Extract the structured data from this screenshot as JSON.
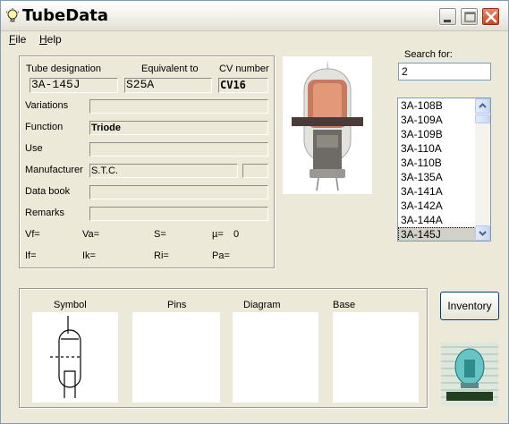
{
  "window": {
    "title": "TubeData"
  },
  "menu": [
    {
      "label": "File",
      "accel": "F",
      "rest": "ile"
    },
    {
      "label": "Help",
      "accel": "H",
      "rest": "elp"
    }
  ],
  "details": {
    "tube_designation_label": "Tube designation",
    "tube_designation_value": "3A-145J",
    "equivalent_label": "Equivalent to",
    "equivalent_value": "S25A",
    "cv_label": "CV number",
    "cv_value": "CV16",
    "variations_label": "Variations",
    "variations_value": "",
    "function_label": "Function",
    "function_value": "Triode",
    "use_label": "Use",
    "use_value": "",
    "manufacturer_label": "Manufacturer",
    "manufacturer_value": "S.T.C.",
    "manufacturer_extra": "",
    "databook_label": "Data book",
    "databook_value": "",
    "remarks_label": "Remarks",
    "remarks_value": ""
  },
  "params": {
    "vf": "Vf=",
    "va": "Va=",
    "s": "S=",
    "mu": "µ=",
    "mu_value": "0",
    "if": "If=",
    "ik": "Ik=",
    "ri": "Ri=",
    "pa": "Pa="
  },
  "search": {
    "label": "Search for:",
    "value": "2"
  },
  "tube_list": {
    "items": [
      "3A-108B",
      "3A-109A",
      "3A-109B",
      "3A-110A",
      "3A-110B",
      "3A-135A",
      "3A-141A",
      "3A-142A",
      "3A-144A",
      "3A-145J"
    ],
    "selected": "3A-145J"
  },
  "bottom": {
    "symbol_label": "Symbol",
    "pins_label": "Pins",
    "diagram_label": "Diagram",
    "base_label": "Base",
    "inventory_label": "Inventory"
  },
  "icons": [
    "lightbulb-icon",
    "minimize-icon",
    "maximize-icon",
    "close-icon",
    "scroll-up-icon",
    "scroll-down-icon",
    "triode-symbol-icon",
    "tube-logo-icon"
  ],
  "colors": {
    "close_button": "#c8421f",
    "list_selection": "#d4d0c8",
    "window_bg": "#ece9d8"
  }
}
